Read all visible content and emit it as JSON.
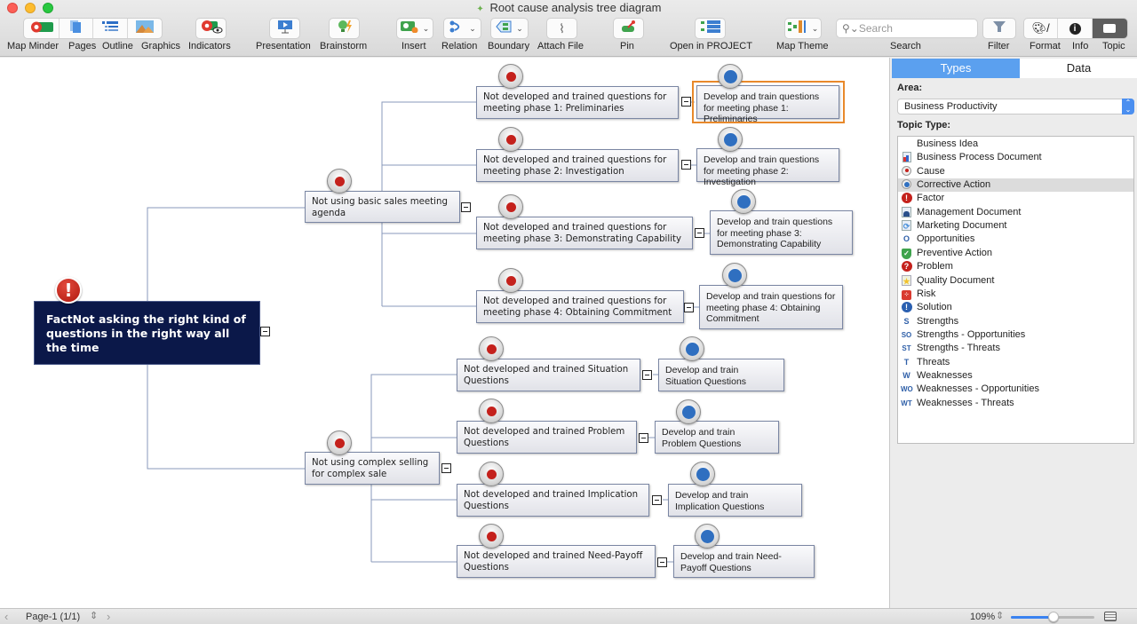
{
  "window": {
    "title": "Root cause analysis tree diagram"
  },
  "toolbar": {
    "map_minder": "Map Minder",
    "pages": "Pages",
    "outline": "Outline",
    "graphics": "Graphics",
    "indicators": "Indicators",
    "presentation": "Presentation",
    "brainstorm": "Brainstorm",
    "insert": "Insert",
    "relation": "Relation",
    "boundary": "Boundary",
    "attach_file": "Attach File",
    "pin": "Pin",
    "open_in_project": "Open in PROJECT",
    "map_theme": "Map Theme",
    "search_label": "Search",
    "search_placeholder": "Search",
    "filter": "Filter",
    "format": "Format",
    "info": "Info",
    "topic": "Topic"
  },
  "map": {
    "root": {
      "text": "FactNot asking the right kind of questions in the right way all the time",
      "marker": "factor-icon"
    },
    "branches": [
      {
        "text": "Not using basic sales meeting agenda",
        "causes": [
          {
            "text": "Not developed and trained questions for meeting phase 1: Preliminaries",
            "solution": "Develop and train questions for meeting phase 1: Preliminaries",
            "selected": true
          },
          {
            "text": "Not developed and trained questions for meeting phase 2: Investigation",
            "solution": "Develop and train questions for meeting phase 2: Investigation"
          },
          {
            "text": "Not developed and trained questions for meeting phase 3: Demonstrating Capability",
            "solution": "Develop and train questions for meeting phase 3: Demonstrating Capability"
          },
          {
            "text": "Not developed and trained questions for meeting phase 4: Obtaining Commitment",
            "solution": "Develop and train questions for meeting phase 4: Obtaining Commitment"
          }
        ]
      },
      {
        "text": "Not using complex selling for complex sale",
        "causes": [
          {
            "text": "Not developed and trained Situation Questions",
            "solution": "Develop and train Situation Questions"
          },
          {
            "text": "Not developed and trained Problem Questions",
            "solution": "Develop and train Problem Questions"
          },
          {
            "text": "Not developed and trained Implication Questions",
            "solution": "Develop and train Implication Questions"
          },
          {
            "text": "Not developed and trained Need-Payoff Questions",
            "solution": "Develop and train Need-Payoff Questions"
          }
        ]
      }
    ],
    "colors": {
      "cause_dot": "#c4211c",
      "solution_dot": "#2f6fc0",
      "root_bg": "#0b1849",
      "selection": "#e8892b"
    }
  },
  "panel": {
    "tabs": [
      {
        "label": "Types",
        "active": true
      },
      {
        "label": "Data",
        "active": false
      }
    ],
    "area_label": "Area:",
    "area_value": "Business Productivity",
    "topic_type_label": "Topic Type:",
    "topic_types": [
      {
        "label": "Business Idea",
        "icon": "none"
      },
      {
        "label": "Business Process Document",
        "icon": "document-chart-icon"
      },
      {
        "label": "Cause",
        "icon": "cause-icon"
      },
      {
        "label": "Corrective Action",
        "icon": "corrective-action-icon",
        "selected": true
      },
      {
        "label": "Factor",
        "icon": "factor-icon"
      },
      {
        "label": "Management Document",
        "icon": "management-document-icon"
      },
      {
        "label": "Marketing Document",
        "icon": "marketing-document-icon"
      },
      {
        "label": "Opportunities",
        "icon": "O"
      },
      {
        "label": "Preventive Action",
        "icon": "shield-icon"
      },
      {
        "label": "Problem",
        "icon": "question-icon"
      },
      {
        "label": "Quality Document",
        "icon": "quality-document-icon"
      },
      {
        "label": "Risk",
        "icon": "dice-icon"
      },
      {
        "label": "Solution",
        "icon": "solution-icon"
      },
      {
        "label": "Strengths",
        "icon": "S"
      },
      {
        "label": "Strengths - Opportunities",
        "icon": "SO"
      },
      {
        "label": "Strengths - Threats",
        "icon": "ST"
      },
      {
        "label": "Threats",
        "icon": "T"
      },
      {
        "label": "Weaknesses",
        "icon": "W"
      },
      {
        "label": "Weaknesses - Opportunities",
        "icon": "WO"
      },
      {
        "label": "Weaknesses - Threats",
        "icon": "WT"
      }
    ]
  },
  "status": {
    "page": "Page-1 (1/1)",
    "zoom": "109%",
    "zoom_slider_fraction": 0.51
  }
}
